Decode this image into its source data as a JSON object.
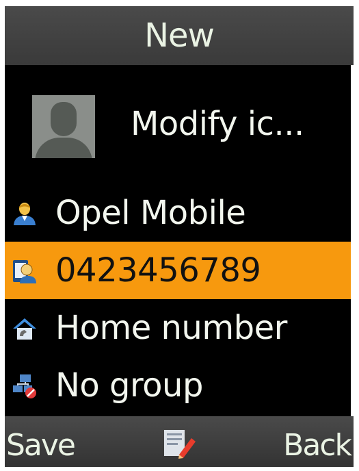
{
  "header": {
    "title": "New"
  },
  "photo": {
    "icon": "avatar-placeholder-icon",
    "label": "Modify ic..."
  },
  "fields": [
    {
      "icon": "contact-person-icon",
      "label": "Opel Mobile",
      "selected": false
    },
    {
      "icon": "mobile-number-icon",
      "label": "0423456789",
      "selected": true
    },
    {
      "icon": "home-number-icon",
      "label": "Home number",
      "selected": false
    },
    {
      "icon": "contact-group-icon",
      "label": "No group",
      "selected": false
    }
  ],
  "softkeys": {
    "left_label": "Save",
    "center_icon": "edit-icon",
    "right_label": "Back"
  },
  "colors": {
    "background": "#000000",
    "bar": "#3f3f3f",
    "selection": "#f7990e",
    "text": "#f2f6ee"
  }
}
